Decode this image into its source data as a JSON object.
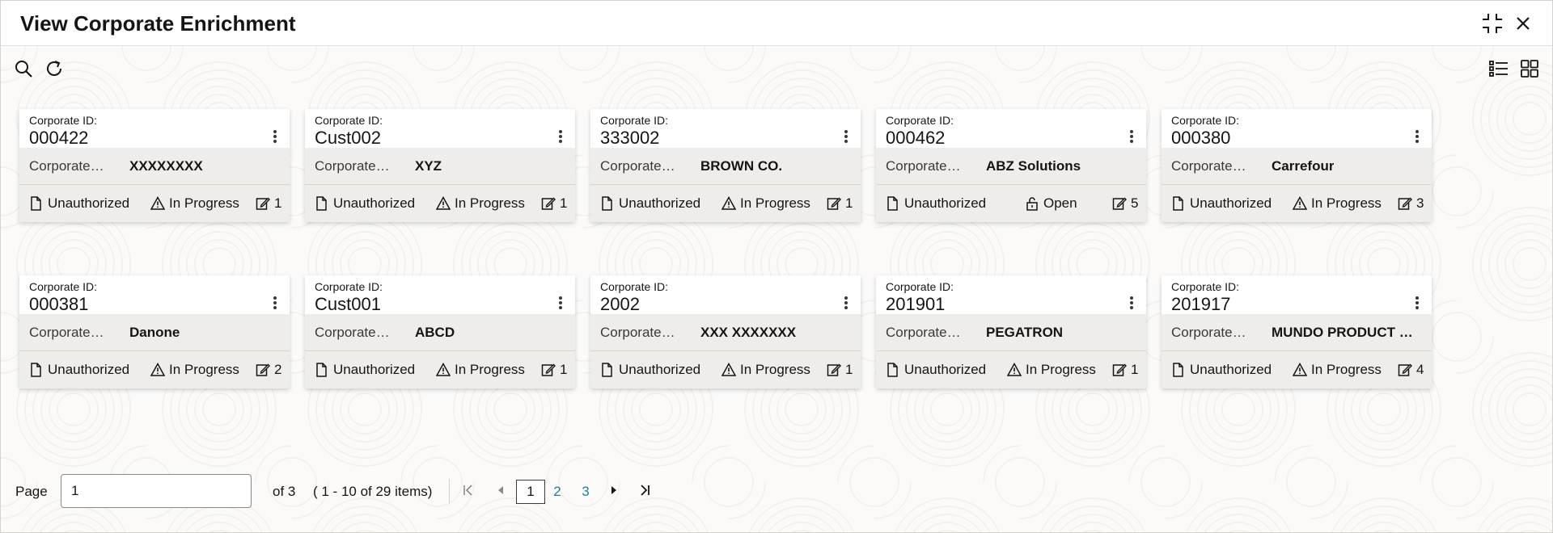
{
  "window": {
    "title": "View Corporate Enrichment"
  },
  "icons": {
    "minimize": "collapse-icon",
    "close": "close-icon",
    "search": "search-icon",
    "refresh": "refresh-icon",
    "list_view": "list-view-icon",
    "grid_view": "grid-view-icon"
  },
  "colors": {
    "link": "#227e9e",
    "card_band": "#efedea"
  },
  "cards": [
    {
      "id_label": "Corporate ID:",
      "id": "000422",
      "name_label": "Corporate…",
      "name": "XXXXXXXX",
      "auth": "Unauthorized",
      "status": "In Progress",
      "status_icon": "warning-icon",
      "count": "1"
    },
    {
      "id_label": "Corporate ID:",
      "id": "Cust002",
      "name_label": "Corporate…",
      "name": "XYZ",
      "auth": "Unauthorized",
      "status": "In Progress",
      "status_icon": "warning-icon",
      "count": "1"
    },
    {
      "id_label": "Corporate ID:",
      "id": "333002",
      "name_label": "Corporate…",
      "name": "BROWN CO.",
      "auth": "Unauthorized",
      "status": "In Progress",
      "status_icon": "warning-icon",
      "count": "1"
    },
    {
      "id_label": "Corporate ID:",
      "id": "000462",
      "name_label": "Corporate…",
      "name": "ABZ Solutions",
      "auth": "Unauthorized",
      "status": "Open",
      "status_icon": "unlock-icon",
      "count": "5"
    },
    {
      "id_label": "Corporate ID:",
      "id": "000380",
      "name_label": "Corporate…",
      "name": "Carrefour",
      "auth": "Unauthorized",
      "status": "In Progress",
      "status_icon": "warning-icon",
      "count": "3"
    },
    {
      "id_label": "Corporate ID:",
      "id": "000381",
      "name_label": "Corporate…",
      "name": "Danone",
      "auth": "Unauthorized",
      "status": "In Progress",
      "status_icon": "warning-icon",
      "count": "2"
    },
    {
      "id_label": "Corporate ID:",
      "id": "Cust001",
      "name_label": "Corporate…",
      "name": "ABCD",
      "auth": "Unauthorized",
      "status": "In Progress",
      "status_icon": "warning-icon",
      "count": "1"
    },
    {
      "id_label": "Corporate ID:",
      "id": "2002",
      "name_label": "Corporate…",
      "name": "XXX XXXXXXX",
      "auth": "Unauthorized",
      "status": "In Progress",
      "status_icon": "warning-icon",
      "count": "1"
    },
    {
      "id_label": "Corporate ID:",
      "id": "201901",
      "name_label": "Corporate…",
      "name": "PEGATRON",
      "auth": "Unauthorized",
      "status": "In Progress",
      "status_icon": "warning-icon",
      "count": "1"
    },
    {
      "id_label": "Corporate ID:",
      "id": "201917",
      "name_label": "Corporate…",
      "name": "MUNDO PRODUCT C…",
      "auth": "Unauthorized",
      "status": "In Progress",
      "status_icon": "warning-icon",
      "count": "4"
    }
  ],
  "pagination": {
    "label": "Page",
    "current_value": "1",
    "of_text": "of 3",
    "range_text": "( 1 - 10 of 29 items)",
    "pages": [
      "1",
      "2",
      "3"
    ],
    "current_page": "1"
  }
}
